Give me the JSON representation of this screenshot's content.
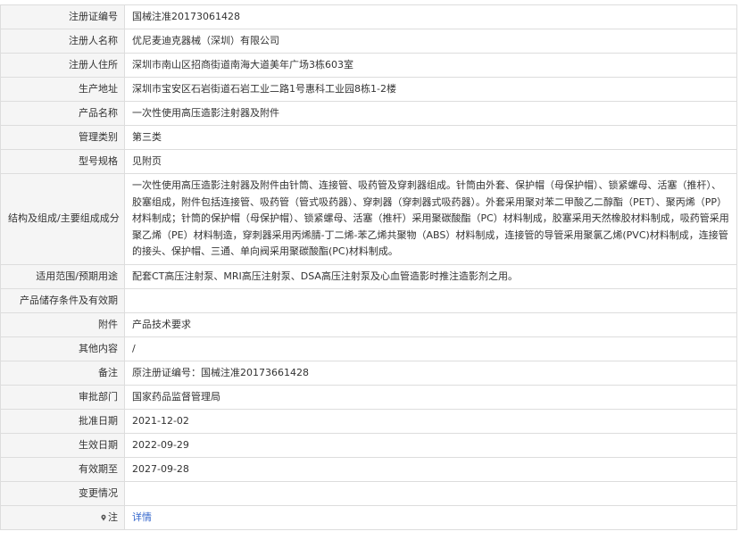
{
  "rows": [
    {
      "label": "注册证编号",
      "value": "国械注准20173061428"
    },
    {
      "label": "注册人名称",
      "value": "优尼麦迪克器械（深圳）有限公司"
    },
    {
      "label": "注册人住所",
      "value": "深圳市南山区招商街道南海大道美年广场3栋603室"
    },
    {
      "label": "生产地址",
      "value": "深圳市宝安区石岩街道石岩工业二路1号惠科工业园8栋1-2楼"
    },
    {
      "label": "产品名称",
      "value": "一次性使用高压造影注射器及附件"
    },
    {
      "label": "管理类别",
      "value": "第三类"
    },
    {
      "label": "型号规格",
      "value": "见附页"
    },
    {
      "label": "结构及组成/主要组成成分",
      "value": "一次性使用高压造影注射器及附件由针筒、连接管、吸药管及穿刺器组成。针筒由外套、保护帽（母保护帽）、锁紧螺母、活塞（推杆）、胶塞组成，附件包括连接管、吸药管（管式吸药器）、穿刺器（穿刺器式吸药器）。外套采用聚对苯二甲酸乙二醇酯（PET）、聚丙烯（PP）材料制成；针筒的保护帽（母保护帽）、锁紧螺母、活塞（推杆）采用聚碳酸酯（PC）材料制成，胶塞采用天然橡胶材料制成，吸药管采用聚乙烯（PE）材料制造，穿刺器采用丙烯腈-丁二烯-苯乙烯共聚物（ABS）材料制成，连接管的导管采用聚氯乙烯(PVC)材料制成，连接管的接头、保护帽、三通、单向阀采用聚碳酸酯(PC)材料制成。"
    },
    {
      "label": "适用范围/预期用途",
      "value": "配套CT高压注射泵、MRI高压注射泵、DSA高压注射泵及心血管造影时推注造影剂之用。"
    },
    {
      "label": "产品储存条件及有效期",
      "value": ""
    },
    {
      "label": "附件",
      "value": "产品技术要求"
    },
    {
      "label": "其他内容",
      "value": "/"
    },
    {
      "label": "备注",
      "value": "原注册证编号：国械注准20173661428"
    },
    {
      "label": "审批部门",
      "value": "国家药品监督管理局"
    },
    {
      "label": "批准日期",
      "value": "2021-12-02"
    },
    {
      "label": "生效日期",
      "value": "2022-09-29"
    },
    {
      "label": "有效期至",
      "value": "2027-09-28"
    },
    {
      "label": "变更情况",
      "value": ""
    },
    {
      "label": "注",
      "value": "详情",
      "icon": "map-pin-icon",
      "link_color": "#3366cc"
    }
  ]
}
